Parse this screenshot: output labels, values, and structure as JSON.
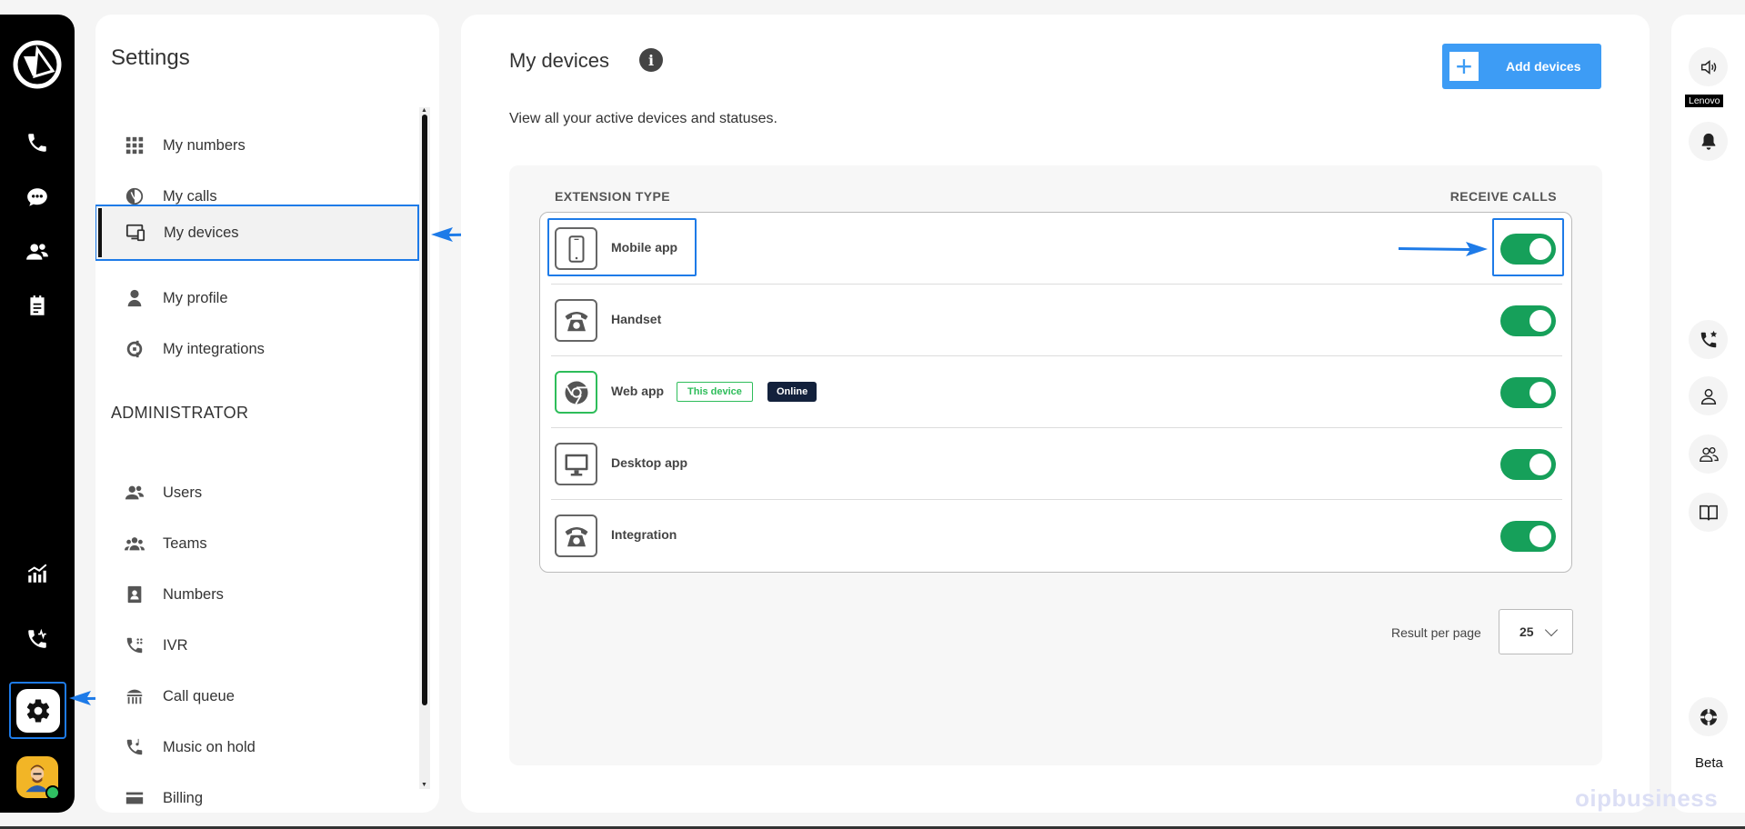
{
  "settings": {
    "title": "Settings",
    "personal_items": [
      {
        "label": "My numbers",
        "icon": "grid-icon"
      },
      {
        "label": "My calls",
        "icon": "calls-history-icon"
      },
      {
        "label": "My devices",
        "icon": "devices-icon",
        "active": true
      },
      {
        "label": "My profile",
        "icon": "person-icon"
      },
      {
        "label": "My integrations",
        "icon": "integrations-icon"
      }
    ],
    "admin_title": "ADMINISTRATOR",
    "admin_items": [
      {
        "label": "Users",
        "icon": "users-icon"
      },
      {
        "label": "Teams",
        "icon": "teams-icon"
      },
      {
        "label": "Numbers",
        "icon": "contact-book-icon"
      },
      {
        "label": "IVR",
        "icon": "ivr-icon"
      },
      {
        "label": "Call queue",
        "icon": "call-queue-icon"
      },
      {
        "label": "Music on hold",
        "icon": "music-hold-icon"
      },
      {
        "label": "Billing",
        "icon": "card-icon"
      }
    ]
  },
  "main": {
    "title": "My devices",
    "description": "View all your active devices and statuses.",
    "add_button": "Add devices",
    "columns": {
      "type": "EXTENSION TYPE",
      "receive": "RECEIVE CALLS"
    },
    "devices": [
      {
        "name": "Mobile app",
        "icon": "mobile-phone-icon",
        "receive_calls": true
      },
      {
        "name": "Handset",
        "icon": "handset-icon",
        "receive_calls": true
      },
      {
        "name": "Web app",
        "icon": "chrome-icon",
        "receive_calls": true,
        "badge": "This device",
        "status": "Online"
      },
      {
        "name": "Desktop app",
        "icon": "desktop-icon",
        "receive_calls": true
      },
      {
        "name": "Integration",
        "icon": "handset-icon",
        "receive_calls": true
      }
    ],
    "result_per_page_label": "Result per page",
    "result_per_page_value": "25"
  },
  "right_rail": {
    "lenovo_label": "Lenovo",
    "beta_label": "Beta"
  },
  "watermark": "oipbusiness",
  "colors": {
    "accent": "#1e7be8",
    "toggle_on": "#16a05a",
    "add_button": "#3d9cf5"
  }
}
